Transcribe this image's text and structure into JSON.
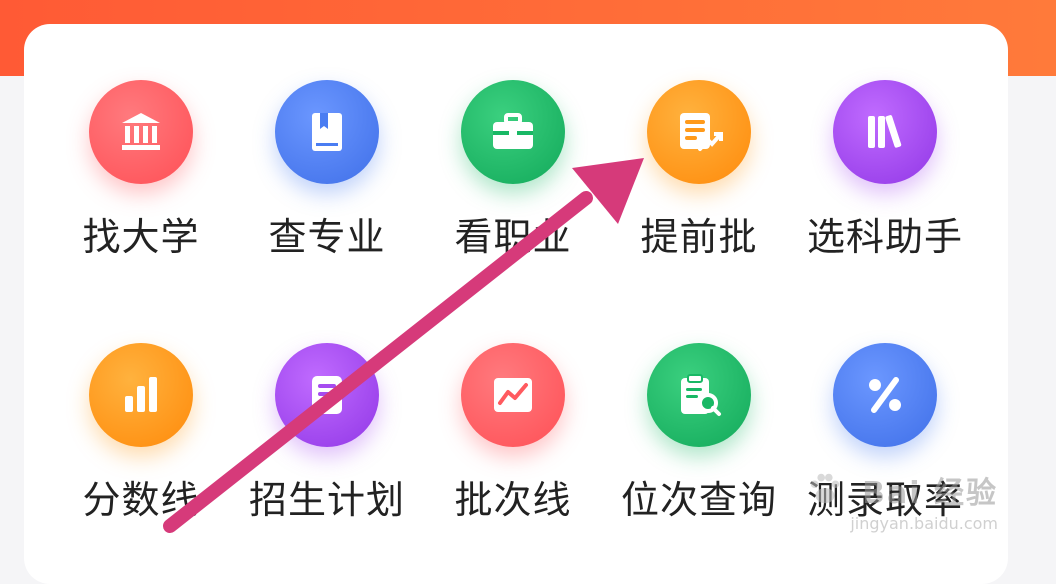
{
  "menu": {
    "row1": [
      {
        "label": "找大学",
        "icon": "university-icon",
        "color": "#ff5a5f"
      },
      {
        "label": "查专业",
        "icon": "book-icon",
        "color": "#4a7df2"
      },
      {
        "label": "看职业",
        "icon": "briefcase-icon",
        "color": "#19b865"
      },
      {
        "label": "提前批",
        "icon": "document-trend-icon",
        "color": "#ff9a1a"
      },
      {
        "label": "选科助手",
        "icon": "books-icon",
        "color": "#a64cf0"
      }
    ],
    "row2": [
      {
        "label": "分数线",
        "icon": "bar-chart-icon",
        "color": "#ff9a1a"
      },
      {
        "label": "招生计划",
        "icon": "plan-document-icon",
        "color": "#a64cf0"
      },
      {
        "label": "批次线",
        "icon": "line-chart-icon",
        "color": "#ff5a5f"
      },
      {
        "label": "位次查询",
        "icon": "clipboard-search-icon",
        "color": "#19b865"
      },
      {
        "label": "测录取率",
        "icon": "percent-icon",
        "color": "#4a7df2"
      }
    ]
  },
  "overlay": {
    "arrow_color": "#d63a7a"
  },
  "watermark": {
    "title": "Bai 经验",
    "url": "jingyan.baidu.com"
  }
}
